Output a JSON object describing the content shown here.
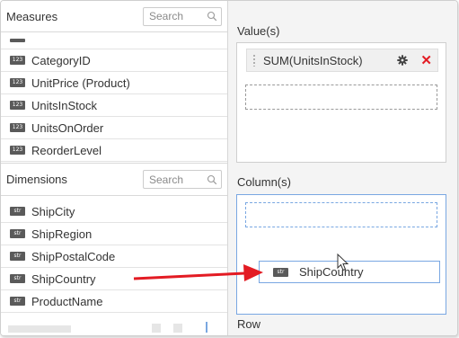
{
  "measures": {
    "title": "Measures",
    "search_placeholder": "Search",
    "items": [
      {
        "label": "CategoryID",
        "badge": "123"
      },
      {
        "label": "UnitPrice (Product)",
        "badge": "123"
      },
      {
        "label": "UnitsInStock",
        "badge": "123"
      },
      {
        "label": "UnitsOnOrder",
        "badge": "123"
      },
      {
        "label": "ReorderLevel",
        "badge": "123"
      }
    ]
  },
  "dimensions": {
    "title": "Dimensions",
    "search_placeholder": "Search",
    "items": [
      {
        "label": "ShipCity",
        "badge": "str"
      },
      {
        "label": "ShipRegion",
        "badge": "str"
      },
      {
        "label": "ShipPostalCode",
        "badge": "str"
      },
      {
        "label": "ShipCountry",
        "badge": "str"
      },
      {
        "label": "ProductName",
        "badge": "str"
      }
    ]
  },
  "values_section": {
    "title": "Value(s)",
    "pill_label": "SUM(UnitsInStock)"
  },
  "columns_section": {
    "title": "Column(s)"
  },
  "row_section": {
    "title": "Row"
  },
  "drag_item": {
    "label": "ShipCountry",
    "badge": "str"
  },
  "colors": {
    "arrow": "#e31b23",
    "drop_highlight": "#79a7e2",
    "badge": "#5a5a5a"
  }
}
